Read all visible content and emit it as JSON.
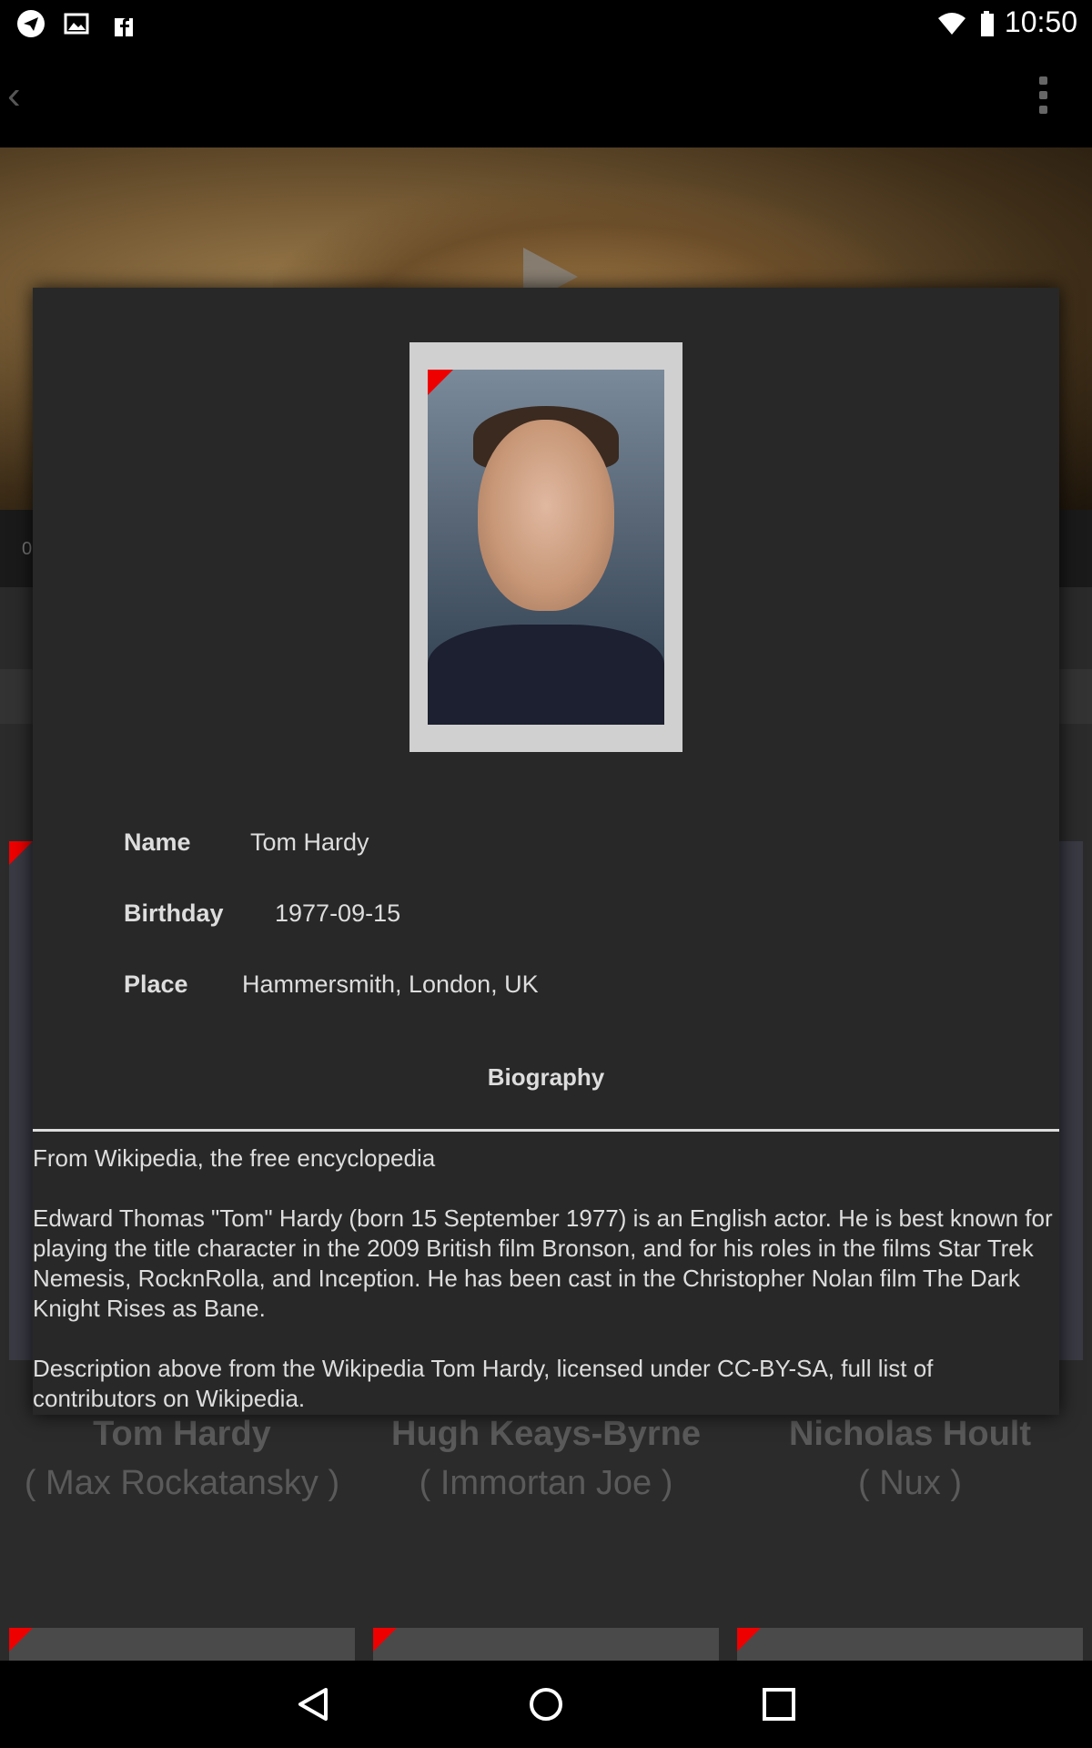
{
  "status_bar": {
    "time": "10:50",
    "left_icons": [
      "telegram-icon",
      "image-icon",
      "facebook-icon"
    ],
    "right_icons": [
      "wifi-icon",
      "battery-icon"
    ]
  },
  "action_bar": {
    "back_glyph": "‹",
    "menu_icon": "overflow-menu-icon"
  },
  "background": {
    "time_fragment": "0",
    "cast": [
      {
        "name": "Tom Hardy",
        "role": "( Max Rockatansky )"
      },
      {
        "name": "Hugh Keays-Byrne",
        "role": "( Immortan Joe )"
      },
      {
        "name": "Nicholas Hoult",
        "role": "( Nux )"
      }
    ]
  },
  "dialog": {
    "name_label": "Name",
    "name_value": "Tom Hardy",
    "birthday_label": "Birthday",
    "birthday_value": "1977-09-15",
    "place_label": "Place",
    "place_value": "Hammersmith, London, UK",
    "biography_title": "Biography",
    "biography": [
      "From Wikipedia, the free encyclopedia",
      "Edward Thomas \"Tom\" Hardy (born 15 September 1977) is an English actor. He is best known for playing the title character in the 2009 British film Bronson, and for his roles in the films Star Trek Nemesis, RocknRolla, and Inception. He has been cast in the Christopher Nolan film The Dark Knight Rises as Bane.",
      "Description above from the Wikipedia Tom Hardy, licensed under CC-BY-SA, full list of contributors on Wikipedia."
    ]
  },
  "nav_bar": {
    "icons": [
      "back-nav-icon",
      "home-nav-icon",
      "recents-nav-icon"
    ]
  },
  "colors": {
    "accent_flag": "#e00000",
    "dialog_bg": "#282828",
    "frame": "#d0d0d0"
  }
}
